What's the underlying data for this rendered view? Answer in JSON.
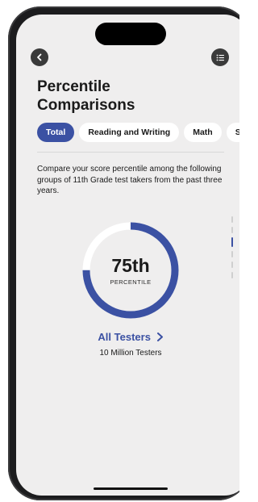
{
  "header": {
    "title_line1": "Percentile",
    "title_line2": "Comparisons"
  },
  "tabs": [
    {
      "label": "Total",
      "active": true
    },
    {
      "label": "Reading and Writing",
      "active": false
    },
    {
      "label": "Math",
      "active": false
    },
    {
      "label": "Sci",
      "active": false
    }
  ],
  "description": "Compare your score percentile among the following groups of 11th Grade test takers from the past three years.",
  "gauge": {
    "value_label": "75th",
    "sub_label": "PERCENTILE",
    "fraction": 0.75
  },
  "group": {
    "link_label": "All Testers",
    "count_label": "10 Million Testers"
  },
  "icons": {
    "back": "chevron-left-icon",
    "menu": "list-icon",
    "chevron": "chevron-right-icon"
  },
  "colors": {
    "accent": "#3b51a3",
    "track": "#ffffff",
    "background": "#efeeee"
  }
}
